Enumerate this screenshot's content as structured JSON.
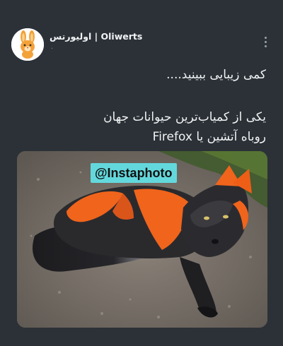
{
  "post": {
    "author_name": "اولیورتس | Oliwerts",
    "meta": "·",
    "text_lines": [
      "کمی زیبایی ببینید....",
      "یکی از کمیاب‌ترین حیوانات جهان",
      "روباه آتشین یا Firefox"
    ],
    "image": {
      "watermark": "@Instaphoto",
      "subject": "fox-photo"
    }
  },
  "colors": {
    "background": "#2b3137",
    "watermark_bg": "#63d8dc",
    "fox_orange": "#f0641c"
  }
}
